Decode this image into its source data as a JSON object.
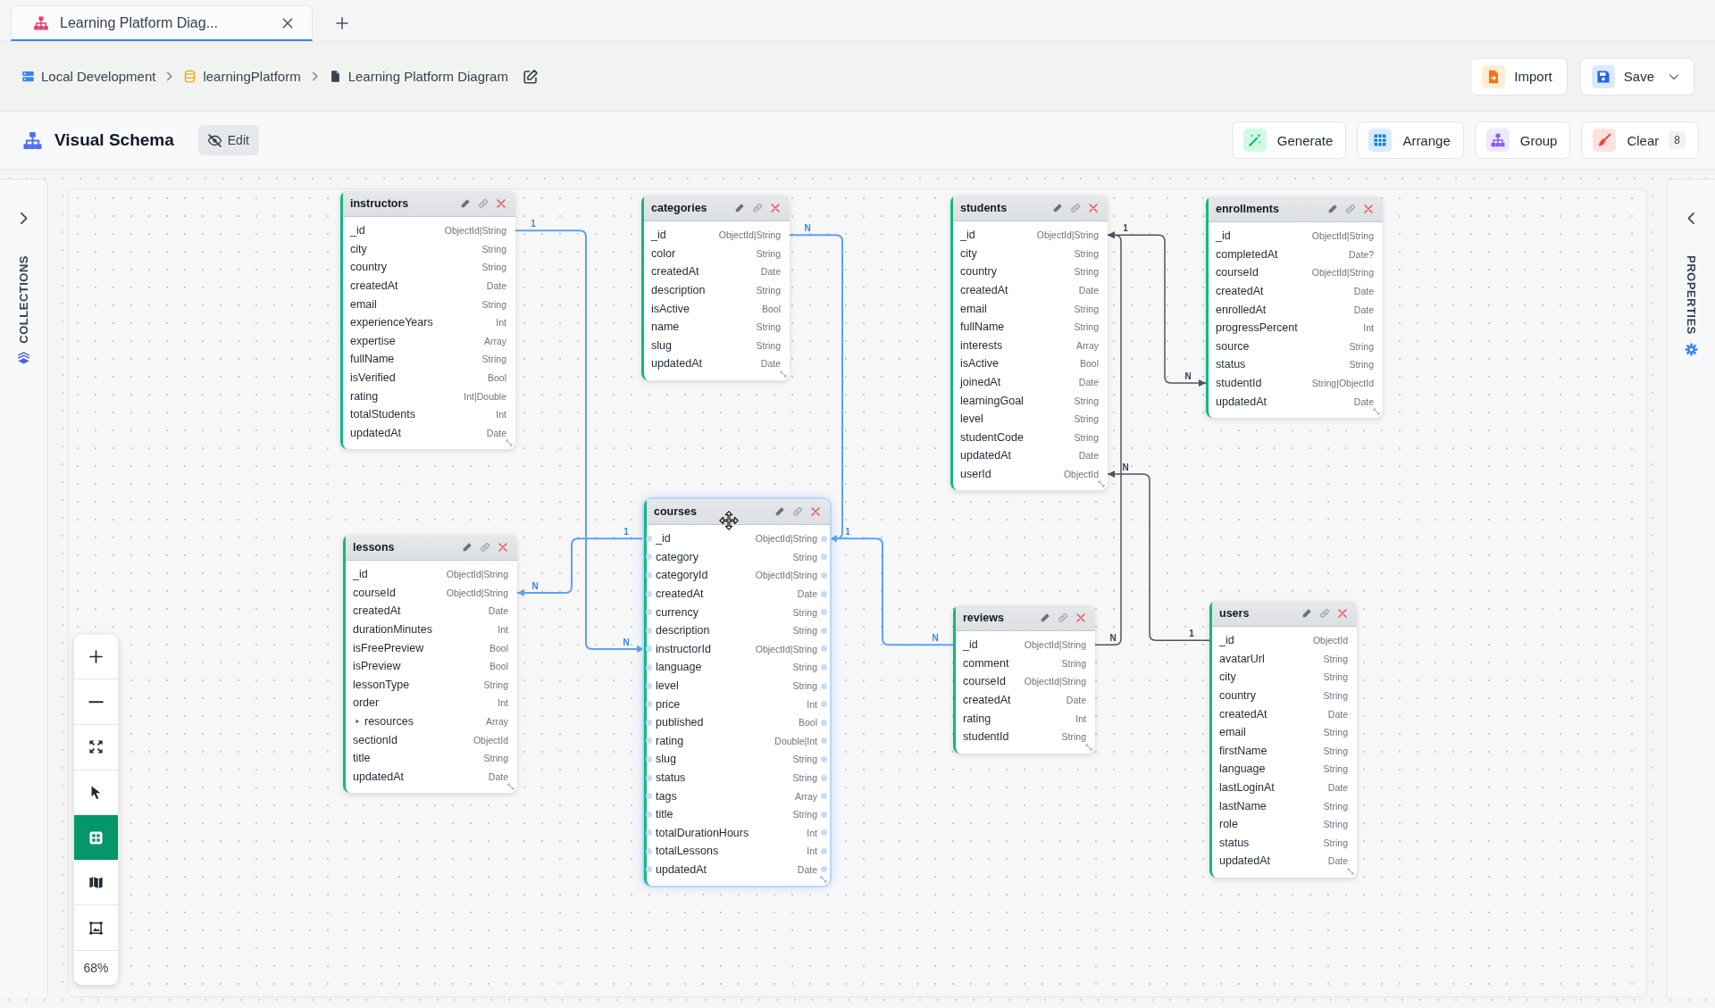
{
  "tabs": [
    {
      "title": "Learning Platform Diag...",
      "selected": true
    }
  ],
  "breadcrumb": [
    "Local Development",
    "learningPlatform",
    "Learning Platform Diagram"
  ],
  "header_actions": [
    {
      "label": "Import",
      "kind": "button"
    },
    {
      "label": "Save",
      "kind": "dropdown"
    }
  ],
  "toolbar": {
    "title": "Visual Schema",
    "edit_button": {
      "label": "Edit"
    },
    "actions": [
      {
        "label": "Generate"
      },
      {
        "label": "Arrange"
      },
      {
        "label": "Group"
      },
      {
        "label": "Clear",
        "count": "8"
      }
    ]
  },
  "collections_panel": {
    "label": "COLLECTIONS",
    "expanded": false
  },
  "tables": [
    {
      "name": "instructors",
      "selected": false,
      "fields": [
        {
          "name": "_id",
          "type": "ObjectId|String"
        },
        {
          "name": "city",
          "type": "String"
        },
        {
          "name": "country",
          "type": "String"
        },
        {
          "name": "createdAt",
          "type": "Date"
        },
        {
          "name": "email",
          "type": "String"
        },
        {
          "name": "experienceYears",
          "type": "Int"
        },
        {
          "name": "expertise",
          "type": "Array"
        },
        {
          "name": "fullName",
          "type": "String"
        },
        {
          "name": "isVerified",
          "type": "Bool"
        },
        {
          "name": "rating",
          "type": "Int|Double"
        },
        {
          "name": "totalStudents",
          "type": "Int"
        },
        {
          "name": "updatedAt",
          "type": "Date"
        }
      ]
    },
    {
      "name": "categories",
      "selected": false,
      "fields": [
        {
          "name": "_id",
          "type": "ObjectId|String"
        },
        {
          "name": "color",
          "type": "String"
        },
        {
          "name": "createdAt",
          "type": "Date"
        },
        {
          "name": "description",
          "type": "String"
        },
        {
          "name": "isActive",
          "type": "Bool"
        },
        {
          "name": "name",
          "type": "String"
        },
        {
          "name": "slug",
          "type": "String"
        },
        {
          "name": "updatedAt",
          "type": "Date"
        }
      ]
    },
    {
      "name": "students",
      "selected": false,
      "fields": [
        {
          "name": "_id",
          "type": "ObjectId|String"
        },
        {
          "name": "city",
          "type": "String"
        },
        {
          "name": "country",
          "type": "String"
        },
        {
          "name": "createdAt",
          "type": "Date"
        },
        {
          "name": "email",
          "type": "String"
        },
        {
          "name": "fullName",
          "type": "String"
        },
        {
          "name": "interests",
          "type": "Array"
        },
        {
          "name": "isActive",
          "type": "Bool"
        },
        {
          "name": "joinedAt",
          "type": "Date"
        },
        {
          "name": "learningGoal",
          "type": "String"
        },
        {
          "name": "level",
          "type": "String"
        },
        {
          "name": "studentCode",
          "type": "String"
        },
        {
          "name": "updatedAt",
          "type": "Date"
        },
        {
          "name": "userId",
          "type": "ObjectId"
        }
      ]
    },
    {
      "name": "enrollments",
      "selected": false,
      "fields": [
        {
          "name": "_id",
          "type": "ObjectId|String"
        },
        {
          "name": "completedAt",
          "type": "Date?"
        },
        {
          "name": "courseId",
          "type": "ObjectId|String"
        },
        {
          "name": "createdAt",
          "type": "Date"
        },
        {
          "name": "enrolledAt",
          "type": "Date"
        },
        {
          "name": "progressPercent",
          "type": "Int"
        },
        {
          "name": "source",
          "type": "String"
        },
        {
          "name": "status",
          "type": "String"
        },
        {
          "name": "studentId",
          "type": "String|ObjectId"
        },
        {
          "name": "updatedAt",
          "type": "Date"
        }
      ]
    },
    {
      "name": "lessons",
      "selected": false,
      "fields": [
        {
          "name": "_id",
          "type": "ObjectId|String",
          "kind": "field"
        },
        {
          "name": "courseId",
          "type": "ObjectId|String",
          "kind": "field"
        },
        {
          "name": "createdAt",
          "type": "Date",
          "kind": "field"
        },
        {
          "name": "durationMinutes",
          "type": "Int",
          "kind": "field"
        },
        {
          "name": "isFreePreview",
          "type": "Bool",
          "kind": "field"
        },
        {
          "name": "isPreview",
          "type": "Bool",
          "kind": "field"
        },
        {
          "name": "lessonType",
          "type": "String",
          "kind": "field"
        },
        {
          "name": "order",
          "type": "Int",
          "kind": "field"
        },
        {
          "name": "resources",
          "type": "Array",
          "kind": "nested"
        },
        {
          "name": "sectionId",
          "type": "ObjectId",
          "kind": "field"
        },
        {
          "name": "title",
          "type": "String",
          "kind": "field"
        },
        {
          "name": "updatedAt",
          "type": "Date",
          "kind": "field"
        }
      ]
    },
    {
      "name": "courses",
      "selected": true,
      "fields": [
        {
          "name": "_id",
          "type": "ObjectId|String"
        },
        {
          "name": "category",
          "type": "String"
        },
        {
          "name": "categoryId",
          "type": "ObjectId|String"
        },
        {
          "name": "createdAt",
          "type": "Date"
        },
        {
          "name": "currency",
          "type": "String"
        },
        {
          "name": "description",
          "type": "String"
        },
        {
          "name": "instructorId",
          "type": "ObjectId|String"
        },
        {
          "name": "language",
          "type": "String"
        },
        {
          "name": "level",
          "type": "String"
        },
        {
          "name": "price",
          "type": "Int"
        },
        {
          "name": "published",
          "type": "Bool"
        },
        {
          "name": "rating",
          "type": "Double|Int"
        },
        {
          "name": "slug",
          "type": "String"
        },
        {
          "name": "status",
          "type": "String"
        },
        {
          "name": "tags",
          "type": "Array"
        },
        {
          "name": "title",
          "type": "String"
        },
        {
          "name": "totalDurationHours",
          "type": "Int"
        },
        {
          "name": "totalLessons",
          "type": "Int"
        },
        {
          "name": "updatedAt",
          "type": "Date"
        }
      ]
    },
    {
      "name": "reviews",
      "selected": false,
      "fields": [
        {
          "name": "_id",
          "type": "ObjectId|String"
        },
        {
          "name": "comment",
          "type": "String"
        },
        {
          "name": "courseId",
          "type": "ObjectId|String"
        },
        {
          "name": "createdAt",
          "type": "Date"
        },
        {
          "name": "rating",
          "type": "Int"
        },
        {
          "name": "studentId",
          "type": "String"
        }
      ]
    },
    {
      "name": "users",
      "selected": false,
      "fields": [
        {
          "name": "_id",
          "type": "ObjectId"
        },
        {
          "name": "avatarUrl",
          "type": "String"
        },
        {
          "name": "city",
          "type": "String"
        },
        {
          "name": "country",
          "type": "String"
        },
        {
          "name": "createdAt",
          "type": "Date"
        },
        {
          "name": "email",
          "type": "String"
        },
        {
          "name": "firstName",
          "type": "String"
        },
        {
          "name": "language",
          "type": "String"
        },
        {
          "name": "lastLoginAt",
          "type": "Date"
        },
        {
          "name": "lastName",
          "type": "String"
        },
        {
          "name": "role",
          "type": "String"
        },
        {
          "name": "status",
          "type": "String"
        },
        {
          "name": "updatedAt",
          "type": "Date"
        }
      ]
    }
  ],
  "relationships": [
    {
      "start_label": "1",
      "end_label": "N",
      "highlighted": true
    },
    {
      "start_label": "N",
      "highlighted": true
    },
    {
      "start_label": "1",
      "end_label": "N",
      "highlighted": true
    },
    {
      "start_label": "1",
      "end_label": "N",
      "highlighted": true
    },
    {
      "start_label": "N",
      "highlighted": false
    },
    {
      "start_label": "1",
      "end_label": "N",
      "highlighted": false
    },
    {
      "start_label": "N",
      "end_label": "1",
      "highlighted": false
    }
  ],
  "canvas_controls": {
    "tools": [
      {
        "selected": false
      },
      {
        "selected": false
      },
      {
        "selected": false
      },
      {
        "selected": false
      },
      {
        "selected": true
      },
      {
        "selected": false
      },
      {
        "selected": false
      }
    ],
    "zoom": "68%"
  },
  "properties_panel": {
    "label": "PROPERTIES",
    "expanded": false
  }
}
